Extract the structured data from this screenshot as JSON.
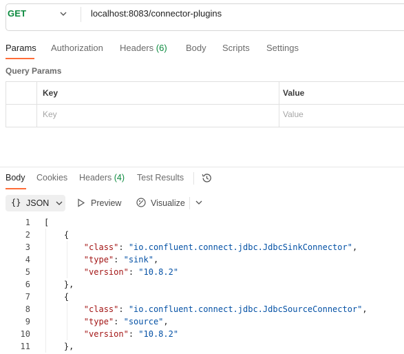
{
  "request": {
    "method": "GET",
    "url": "localhost:8083/connector-plugins"
  },
  "request_tabs": [
    {
      "label": "Params",
      "active": true
    },
    {
      "label": "Authorization"
    },
    {
      "label": "Headers",
      "count": "(6)"
    },
    {
      "label": "Body"
    },
    {
      "label": "Scripts"
    },
    {
      "label": "Settings"
    }
  ],
  "query_params": {
    "title": "Query Params",
    "columns": [
      "Key",
      "Value"
    ],
    "placeholders": {
      "key": "Key",
      "value": "Value"
    }
  },
  "response_tabs": [
    {
      "label": "Body",
      "active": true
    },
    {
      "label": "Cookies"
    },
    {
      "label": "Headers",
      "count": "(4)"
    },
    {
      "label": "Test Results"
    }
  ],
  "toolbar": {
    "format_icon": "{}",
    "format": "JSON",
    "preview": "Preview",
    "visualize": "Visualize"
  },
  "code_lines": [
    {
      "n": "1",
      "text": "["
    },
    {
      "n": "2",
      "text": "    {"
    },
    {
      "n": "3",
      "key": "\"class\"",
      "value": "\"io.confluent.connect.jdbc.JdbcSinkConnector\"",
      "trail": ","
    },
    {
      "n": "4",
      "key": "\"type\"",
      "value": "\"sink\"",
      "trail": ","
    },
    {
      "n": "5",
      "key": "\"version\"",
      "value": "\"10.8.2\"",
      "trail": ""
    },
    {
      "n": "6",
      "text": "    },"
    },
    {
      "n": "7",
      "text": "    {"
    },
    {
      "n": "8",
      "key": "\"class\"",
      "value": "\"io.confluent.connect.jdbc.JdbcSourceConnector\"",
      "trail": ","
    },
    {
      "n": "9",
      "key": "\"type\"",
      "value": "\"source\"",
      "trail": ","
    },
    {
      "n": "10",
      "key": "\"version\"",
      "value": "\"10.8.2\"",
      "trail": ""
    },
    {
      "n": "11",
      "text": "    },"
    }
  ],
  "colors": {
    "accent": "#ff6c37",
    "method_get": "#0b8a3e",
    "json_key": "#a31515",
    "json_string": "#0451a5"
  },
  "icons": [
    "chevron-down-icon",
    "history-icon",
    "braces-icon",
    "play-icon",
    "visualize-icon"
  ]
}
